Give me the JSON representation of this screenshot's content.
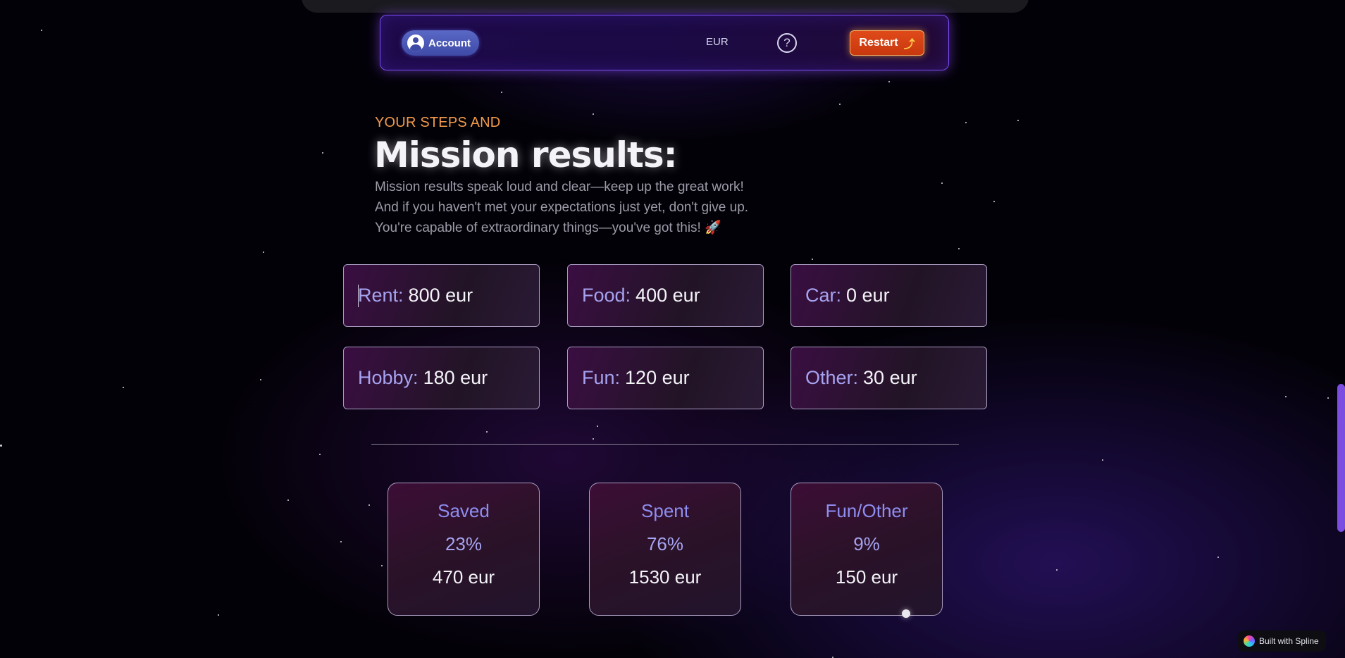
{
  "navbar": {
    "account_label": "Account",
    "currency": "EUR",
    "restart_label": "Restart"
  },
  "hero": {
    "eyebrow": "YOUR STEPS AND",
    "title": "Mission results:",
    "intro_lines": [
      "Mission results speak loud and clear—keep up the great work!",
      "And if you haven't met your expectations just yet, don't give up.",
      "You're capable of extraordinary things—you've got this! 🚀"
    ]
  },
  "expenses": [
    {
      "label": "Rent:",
      "value": "800 eur"
    },
    {
      "label": "Food:",
      "value": "400 eur"
    },
    {
      "label": "Car:",
      "value": "0 eur"
    },
    {
      "label": "Hobby:",
      "value": "180 eur"
    },
    {
      "label": "Fun:",
      "value": "120 eur"
    },
    {
      "label": "Other:",
      "value": "30 eur"
    }
  ],
  "summary": [
    {
      "title": "Saved",
      "percent": "23%",
      "amount": "470 eur"
    },
    {
      "title": "Spent",
      "percent": "76%",
      "amount": "1530 eur"
    },
    {
      "title": "Fun/Other",
      "percent": "9%",
      "amount": "150 eur"
    }
  ],
  "badge": {
    "label": "Built with Spline"
  },
  "colors": {
    "accent_orange": "#f29a4a",
    "label_purple": "#a6a3f0",
    "restart_red": "#d8421a",
    "nav_border": "#7a4cf0",
    "scrollbar": "#7b4de0"
  },
  "icons": {
    "account": "user-avatar-icon",
    "help": "question-circle-icon",
    "restart": "rocket-icon",
    "badge": "spline-logo-icon"
  }
}
